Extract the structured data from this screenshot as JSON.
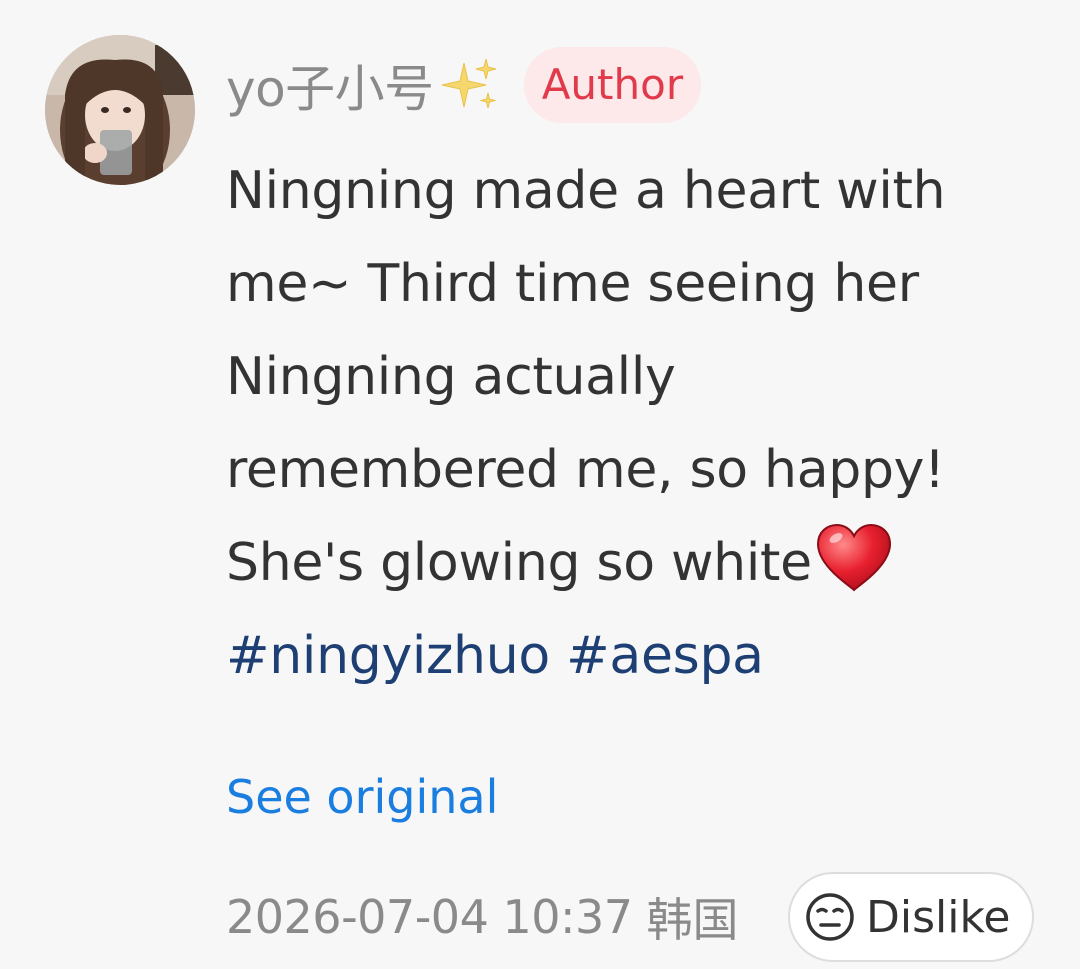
{
  "comment": {
    "username": "yo子小号",
    "username_icon": "sparkle-icon",
    "author_badge": "Author",
    "avatar": "user-avatar-photo",
    "text_lines": [
      "Ningning made a heart with",
      "me~ Third time seeing her",
      "Ningning actually",
      "remembered me, so happy!",
      "She's glowing so white"
    ],
    "heart_icon": "red-heart-icon",
    "hashtags": [
      "#ningyizhuo",
      "#aespa"
    ],
    "see_original": "See original",
    "timestamp": "2026-07-04 10:37",
    "location": "韩国",
    "dislike_label": "Dislike",
    "dislike_icon": "unamused-face-icon"
  },
  "colors": {
    "background": "#f7f7f7",
    "username": "#8a8a8a",
    "badge_bg": "#fde8ea",
    "badge_text": "#e03a4b",
    "body_text": "#333333",
    "hashtag": "#1e3f73",
    "link": "#1a7de0",
    "meta": "#8a8a8a"
  }
}
